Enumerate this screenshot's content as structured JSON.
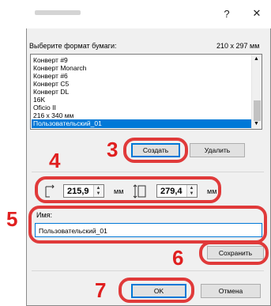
{
  "window": {
    "help_glyph": "?",
    "close_glyph": "✕"
  },
  "format": {
    "label": "Выберите формат бумаги:",
    "size": "210 x 297 мм"
  },
  "paper_list": {
    "items": [
      "Конверт #9",
      "Конверт Monarch",
      "Конверт #6",
      "Конверт C5",
      "Конверт DL",
      "16K",
      "Oficio II",
      "216 x 340 мм",
      "Пользовательский_01"
    ],
    "selected_index": 8
  },
  "buttons": {
    "create": "Создать",
    "delete": "Удалить",
    "save": "Сохранить",
    "ok": "OK",
    "cancel": "Отмена"
  },
  "dimensions": {
    "width_value": "215,9",
    "height_value": "279,4",
    "unit": "мм"
  },
  "name_field": {
    "label": "Имя:",
    "value": "Пользовательский_01"
  },
  "step_markers": {
    "step3": "3",
    "step4": "4",
    "step5": "5",
    "step6": "6",
    "step7": "7"
  },
  "colors": {
    "annotation": "#e03a3a",
    "selection": "#0078d7"
  }
}
